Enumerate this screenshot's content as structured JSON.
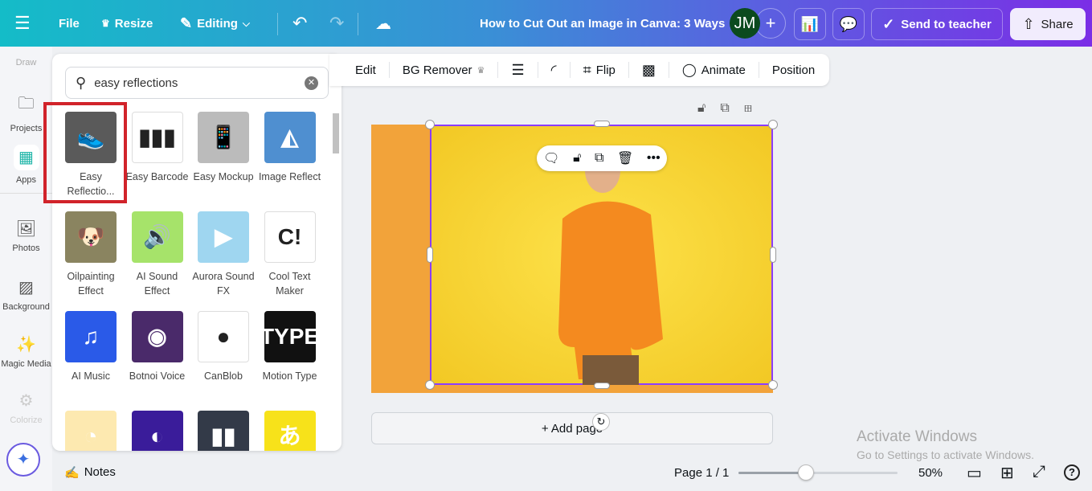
{
  "header": {
    "menu_icon": "hamburger-icon",
    "file": "File",
    "resize": "Resize",
    "editing": "Editing",
    "title": "How to Cut Out an Image in Canva: 3 Ways",
    "avatar": "JM",
    "send_to_teacher": "Send to teacher",
    "share": "Share"
  },
  "rail": {
    "items": [
      {
        "label": "Draw"
      },
      {
        "label": "Projects"
      },
      {
        "label": "Apps"
      },
      {
        "label": "Photos"
      },
      {
        "label": "Background"
      },
      {
        "label": "Magic Media"
      },
      {
        "label": "Colorize"
      }
    ]
  },
  "search": {
    "value": "easy reflections"
  },
  "apps": [
    {
      "label": "Easy Reflectio...",
      "color": "#5a5a5a"
    },
    {
      "label": "Easy Barcode",
      "color": "#ffffff"
    },
    {
      "label": "Easy Mockup",
      "color": "#bbbbbb"
    },
    {
      "label": "Image Reflect",
      "color": "#4f8fd0"
    },
    {
      "label": "Oilpainting Effect",
      "color": "#8a8460"
    },
    {
      "label": "AI Sound Effect",
      "color": "#a6e36a"
    },
    {
      "label": "Aurora Sound FX",
      "color": "#9fd6f0"
    },
    {
      "label": "Cool Text Maker",
      "color": "#ffffff"
    },
    {
      "label": "AI Music",
      "color": "#2a5ae8"
    },
    {
      "label": "Botnoi Voice",
      "color": "#4a2a6a"
    },
    {
      "label": "CanBlob",
      "color": "#ffffff"
    },
    {
      "label": "Motion Type",
      "color": "#111111"
    },
    {
      "label": "",
      "color": "#fde9b0"
    },
    {
      "label": "",
      "color": "#3a1c9a"
    },
    {
      "label": "",
      "color": "#333a48"
    },
    {
      "label": "",
      "color": "#f7e21a"
    }
  ],
  "toolbar": {
    "edit": "Edit",
    "bg_remover": "BG Remover",
    "flip": "Flip",
    "animate": "Animate",
    "position": "Position"
  },
  "canvas": {
    "add_page": "+ Add page"
  },
  "bottom": {
    "notes": "Notes",
    "page": "Page 1 / 1",
    "zoom": "50%",
    "zoom_percent": 50
  },
  "watermark": {
    "title": "Activate Windows",
    "subtitle": "Go to Settings to activate Windows."
  }
}
